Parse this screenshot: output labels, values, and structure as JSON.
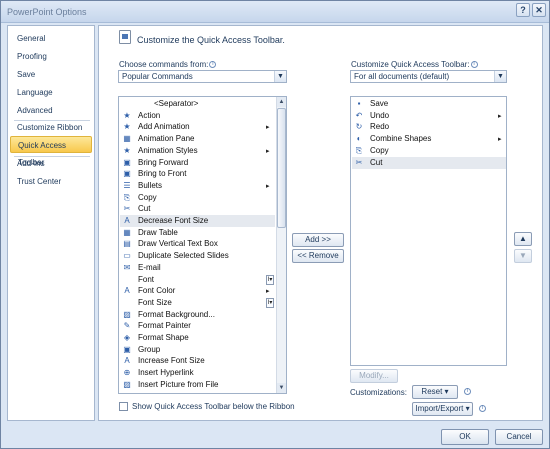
{
  "window": {
    "title": "PowerPoint Options",
    "help": "?",
    "close": "✕"
  },
  "nav": {
    "items": [
      {
        "label": "General"
      },
      {
        "label": "Proofing"
      },
      {
        "label": "Save"
      },
      {
        "label": "Language"
      },
      {
        "label": "Advanced"
      },
      {
        "label": "Customize Ribbon"
      },
      {
        "label": "Quick Access Toolbar"
      },
      {
        "label": "Add-Ins"
      },
      {
        "label": "Trust Center"
      }
    ],
    "selected_index": 6
  },
  "header": {
    "title": "Customize the Quick Access Toolbar."
  },
  "choose": {
    "label": "Choose commands from:",
    "value": "Popular Commands",
    "commands": [
      {
        "label": "<Separator>",
        "icon": "",
        "sub": ""
      },
      {
        "label": "Action",
        "icon": "★",
        "sub": ""
      },
      {
        "label": "Add Animation",
        "icon": "★",
        "sub": "▸"
      },
      {
        "label": "Animation Pane",
        "icon": "▦",
        "sub": ""
      },
      {
        "label": "Animation Styles",
        "icon": "★",
        "sub": "▸"
      },
      {
        "label": "Bring Forward",
        "icon": "▣",
        "sub": ""
      },
      {
        "label": "Bring to Front",
        "icon": "▣",
        "sub": ""
      },
      {
        "label": "Bullets",
        "icon": "☰",
        "sub": "▸"
      },
      {
        "label": "Copy",
        "icon": "⎘",
        "sub": ""
      },
      {
        "label": "Cut",
        "icon": "✂",
        "sub": ""
      },
      {
        "label": "Decrease Font Size",
        "icon": "A",
        "sub": ""
      },
      {
        "label": "Draw Table",
        "icon": "▦",
        "sub": ""
      },
      {
        "label": "Draw Vertical Text Box",
        "icon": "▤",
        "sub": ""
      },
      {
        "label": "Duplicate Selected Slides",
        "icon": "▭",
        "sub": ""
      },
      {
        "label": "E-mail",
        "icon": "✉",
        "sub": ""
      },
      {
        "label": "Font",
        "icon": "",
        "sub": "I▾"
      },
      {
        "label": "Font Color",
        "icon": "A",
        "sub": "▸"
      },
      {
        "label": "Font Size",
        "icon": "",
        "sub": "I▾"
      },
      {
        "label": "Format Background...",
        "icon": "▨",
        "sub": ""
      },
      {
        "label": "Format Painter",
        "icon": "✎",
        "sub": ""
      },
      {
        "label": "Format Shape",
        "icon": "◈",
        "sub": ""
      },
      {
        "label": "Group",
        "icon": "▣",
        "sub": ""
      },
      {
        "label": "Increase Font Size",
        "icon": "A",
        "sub": ""
      },
      {
        "label": "Insert Hyperlink",
        "icon": "⊕",
        "sub": ""
      },
      {
        "label": "Insert Picture from File",
        "icon": "▨",
        "sub": ""
      }
    ],
    "selected_index": 10
  },
  "customize": {
    "label": "Customize Quick Access Toolbar:",
    "value": "For all documents (default)",
    "items": [
      {
        "label": "Save",
        "icon": "▪",
        "sub": ""
      },
      {
        "label": "Undo",
        "icon": "↶",
        "sub": "▸"
      },
      {
        "label": "Redo",
        "icon": "↻",
        "sub": ""
      },
      {
        "label": "Combine Shapes",
        "icon": "◐",
        "sub": "▸"
      },
      {
        "label": "Copy",
        "icon": "⎘",
        "sub": ""
      },
      {
        "label": "Cut",
        "icon": "✂",
        "sub": ""
      }
    ],
    "selected_index": 5
  },
  "buttons": {
    "add": "Add >>",
    "remove": "<< Remove",
    "modify": "Modify...",
    "reset": "Reset ▾",
    "import_export": "Import/Export ▾",
    "move_up": "▲",
    "move_down": "▼",
    "ok": "OK",
    "cancel": "Cancel"
  },
  "customizations_label": "Customizations:",
  "show_below_ribbon": {
    "label": "Show Quick Access Toolbar below the Ribbon",
    "checked": false
  }
}
